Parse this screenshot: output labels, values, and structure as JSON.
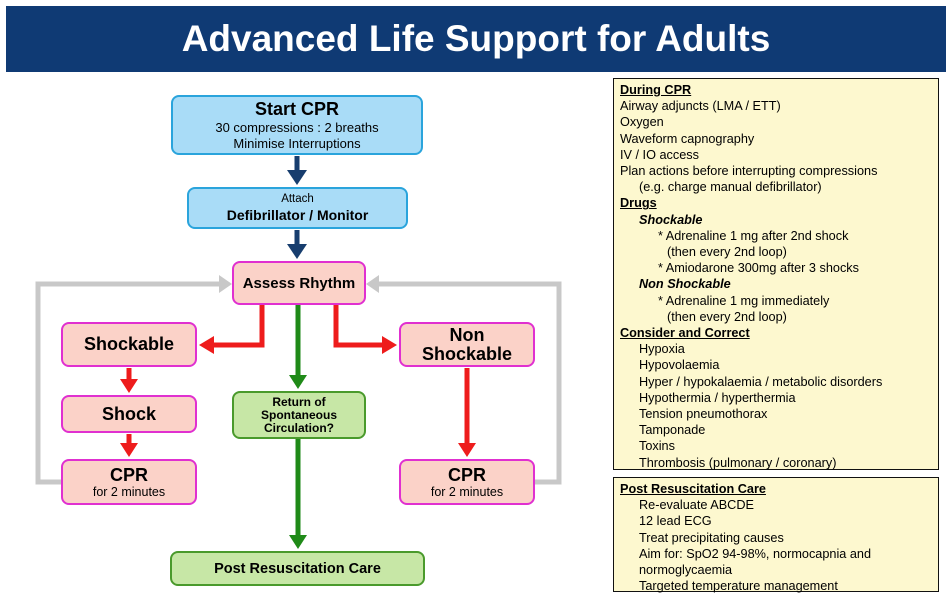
{
  "header": {
    "title": "Advanced Life Support for Adults"
  },
  "flow": {
    "start_cpr": {
      "title": "Start CPR",
      "line1": "30 compressions : 2 breaths",
      "line2": "Minimise Interruptions"
    },
    "attach": {
      "small": "Attach",
      "title": "Defibrillator / Monitor"
    },
    "assess_rhythm": "Assess Rhythm",
    "shockable": "Shockable",
    "shock": "Shock",
    "cpr_left": {
      "title": "CPR",
      "sub": "for 2 minutes"
    },
    "non_shockable": {
      "line1": "Non",
      "line2": "Shockable"
    },
    "cpr_right": {
      "title": "CPR",
      "sub": "for 2 minutes"
    },
    "rosc": {
      "line1": "Return of",
      "line2": "Spontaneous",
      "line3": "Circulation?"
    },
    "post_care": "Post Resuscitation Care"
  },
  "during_panel": {
    "heading": "During CPR",
    "items": [
      "Airway adjuncts (LMA / ETT)",
      "Oxygen",
      "Waveform capnography",
      "IV / IO access",
      "Plan actions before interrupting compressions"
    ],
    "items_note": "(e.g. charge manual defibrillator)",
    "drugs_heading": "Drugs",
    "shockable_heading": "Shockable",
    "shockable_1a": "* Adrenaline 1 mg after 2nd shock",
    "shockable_1b": "(then every 2nd loop)",
    "shockable_2": "* Amiodarone 300mg after 3 shocks",
    "nonshockable_heading": "Non Shockable",
    "nonshockable_1a": "* Adrenaline 1 mg immediately",
    "nonshockable_1b": "(then every 2nd loop)",
    "consider_heading": "Consider and Correct",
    "consider_items": [
      "Hypoxia",
      "Hypovolaemia",
      "Hyper / hypokalaemia / metabolic disorders",
      "Hypothermia / hyperthermia",
      "Tension pneumothorax",
      "Tamponade",
      "Toxins",
      "Thrombosis (pulmonary / coronary)"
    ]
  },
  "post_panel": {
    "heading": "Post Resuscitation Care",
    "items": [
      "Re-evaluate ABCDE",
      "12 lead ECG",
      "Treat precipitating causes",
      "Aim for: SpO2 94-98%, normocapnia and",
      "normoglycaemia",
      "Targeted temperature management"
    ]
  },
  "colors": {
    "header_bg": "#0f3a74",
    "blue_box": "#a9dcf7",
    "pink_box": "#fbd2c8",
    "green_box": "#c7e7a6",
    "panel_bg": "#fdf8cf",
    "arrow_navy": "#173d6e",
    "arrow_red": "#ee1c1c",
    "arrow_green": "#1f8a18",
    "loop_gray": "#c8c8c8"
  }
}
